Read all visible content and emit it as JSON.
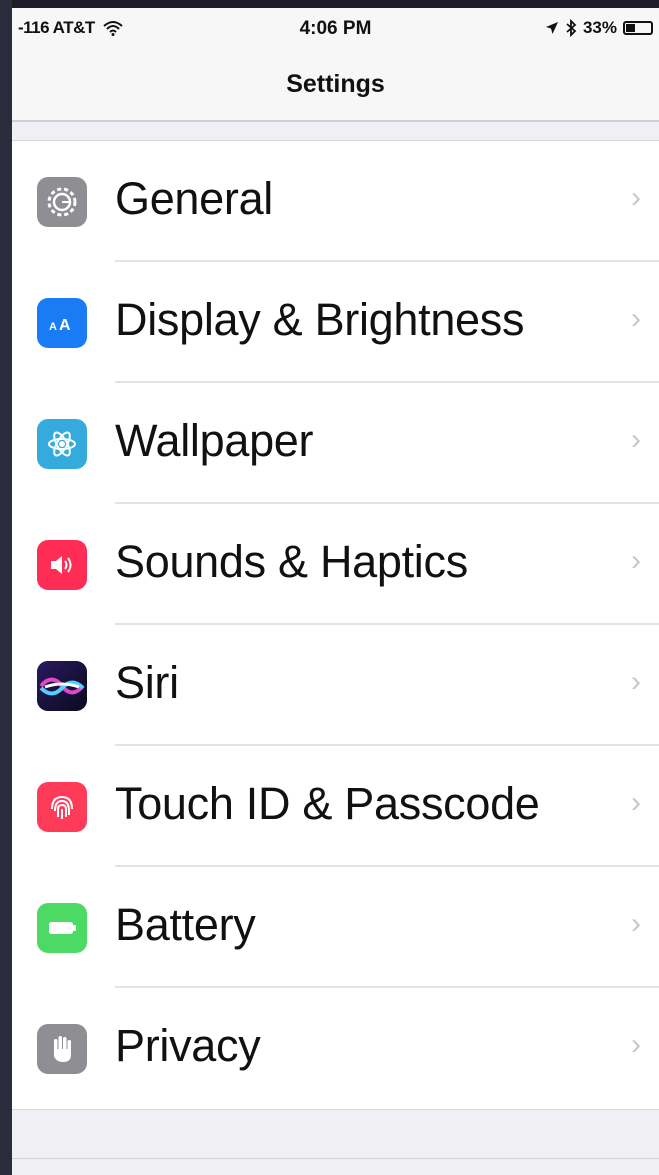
{
  "status_bar": {
    "carrier": "-116 AT&T",
    "time": "4:06 PM",
    "battery_percent": "33%",
    "battery_level": 0.33
  },
  "nav": {
    "title": "Settings"
  },
  "settings": [
    {
      "label": "General",
      "icon": "gear-icon",
      "color": "#8e8e93"
    },
    {
      "label": "Display & Brightness",
      "icon": "text-size-icon",
      "color": "#1a7cf5"
    },
    {
      "label": "Wallpaper",
      "icon": "flower-icon",
      "color": "#35aadc"
    },
    {
      "label": "Sounds & Haptics",
      "icon": "speaker-icon",
      "color": "#ff2d55"
    },
    {
      "label": "Siri",
      "icon": "siri-icon",
      "color": "#1c1c3a"
    },
    {
      "label": "Touch ID & Passcode",
      "icon": "fingerprint-icon",
      "color": "#ff3b5a"
    },
    {
      "label": "Battery",
      "icon": "battery-icon",
      "color": "#4cd964"
    },
    {
      "label": "Privacy",
      "icon": "hand-icon",
      "color": "#8e8e93"
    }
  ],
  "chevron": "›"
}
